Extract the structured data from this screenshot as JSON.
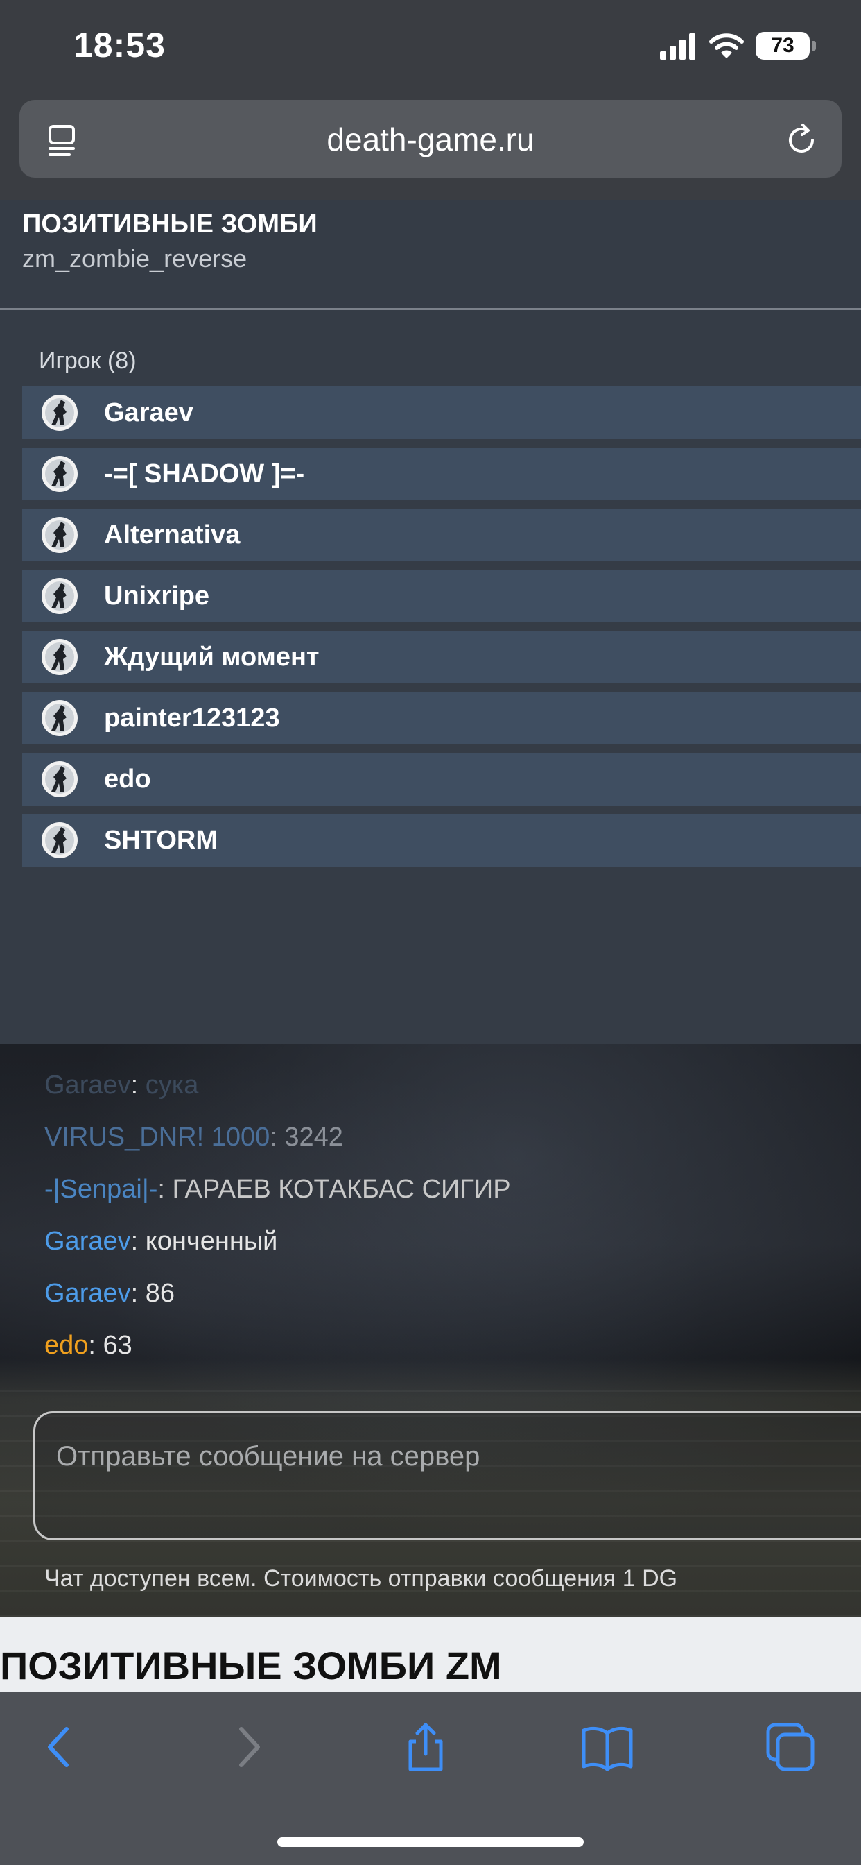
{
  "status_bar": {
    "time": "18:53",
    "battery": "73"
  },
  "browser": {
    "url": "death-game.ru",
    "toolbar": {
      "back": "back",
      "forward": "forward",
      "share": "share",
      "bookmarks": "bookmarks",
      "tabs": "tabs"
    }
  },
  "server": {
    "name": "ПОЗИТИВНЫЕ ЗОМБИ",
    "map": "zm_zombie_reverse"
  },
  "players": {
    "title": "Игрок (8)",
    "items": [
      {
        "name": "Garaev"
      },
      {
        "name": "-=[ SHADOW ]=-"
      },
      {
        "name": "Alternativa"
      },
      {
        "name": "Unixripe"
      },
      {
        "name": "Ждущий момент"
      },
      {
        "name": "painter123123"
      },
      {
        "name": "edo"
      },
      {
        "name": "SHTORM"
      }
    ]
  },
  "chat": {
    "messages": [
      {
        "author": "Garaev",
        "text": "сука",
        "color": "#3c4a5c"
      },
      {
        "author": "VIRUS_DNR! 1000",
        "text": "3242",
        "color": "#4a6e98"
      },
      {
        "author": "-|Senpai|-",
        "text": "ГАРАЕВ КОТАКБАС СИГИР",
        "color": "#4a85c2"
      },
      {
        "author": "Garaev",
        "text": "конченный",
        "color": "#4d9be8"
      },
      {
        "author": "Garaev",
        "text": "86",
        "color": "#4d9be8"
      },
      {
        "author": "edo",
        "text": "63",
        "color": "#f0a01e"
      }
    ],
    "separator": ": ",
    "input_placeholder": "Отправьте сообщение на сервер",
    "note": "Чат доступен всем. Стоимость отправки сообщения 1 DG"
  },
  "page_heading": "ПОЗИТИВНЫЕ ЗОМБИ ZM",
  "colors": {
    "accent": "#3e8ef7",
    "player_row": "#3f4e61",
    "panel": "#353c46"
  }
}
